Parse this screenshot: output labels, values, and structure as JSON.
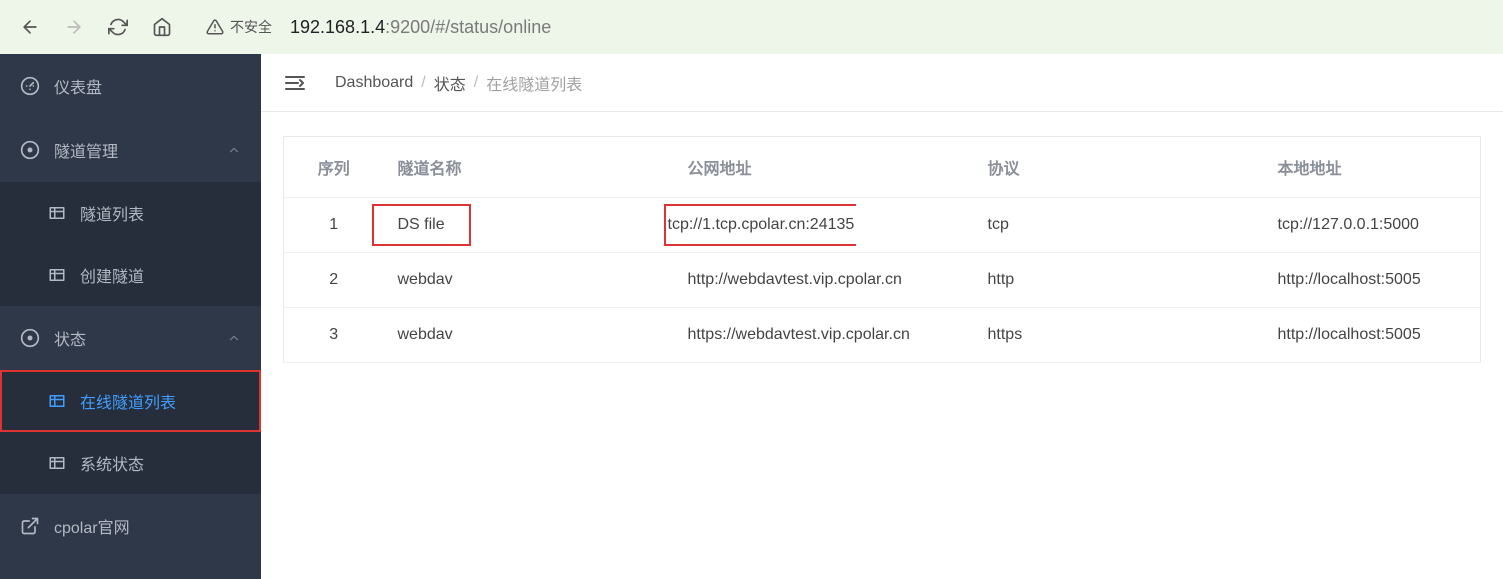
{
  "browser": {
    "security_label": "不安全",
    "url_host": "192.168.1.4",
    "url_port": ":9200",
    "url_path": "/#/status/online"
  },
  "sidebar": {
    "items": [
      {
        "label": "仪表盘",
        "icon": "dashboard-icon"
      },
      {
        "label": "隧道管理",
        "icon": "circle-dot-icon",
        "expandable": true
      },
      {
        "label": "隧道列表",
        "icon": "grid-icon",
        "sub": true
      },
      {
        "label": "创建隧道",
        "icon": "grid-icon",
        "sub": true
      },
      {
        "label": "状态",
        "icon": "circle-dot-icon",
        "expandable": true
      },
      {
        "label": "在线隧道列表",
        "icon": "grid-icon",
        "sub": true,
        "active": true,
        "highlighted": true
      },
      {
        "label": "系统状态",
        "icon": "grid-icon",
        "sub": true
      },
      {
        "label": "cpolar官网",
        "icon": "external-link-icon"
      }
    ]
  },
  "breadcrumb": {
    "items": [
      "Dashboard",
      "状态",
      "在线隧道列表"
    ]
  },
  "table": {
    "headers": {
      "seq": "序列",
      "name": "隧道名称",
      "public": "公网地址",
      "proto": "协议",
      "local": "本地地址"
    },
    "rows": [
      {
        "seq": "1",
        "name": "DS file",
        "public": "tcp://1.tcp.cpolar.cn:24135",
        "proto": "tcp",
        "local": "tcp://127.0.0.1:5000",
        "highlighted": true
      },
      {
        "seq": "2",
        "name": "webdav",
        "public": "http://webdavtest.vip.cpolar.cn",
        "proto": "http",
        "local": "http://localhost:5005"
      },
      {
        "seq": "3",
        "name": "webdav",
        "public": "https://webdavtest.vip.cpolar.cn",
        "proto": "https",
        "local": "http://localhost:5005"
      }
    ]
  }
}
